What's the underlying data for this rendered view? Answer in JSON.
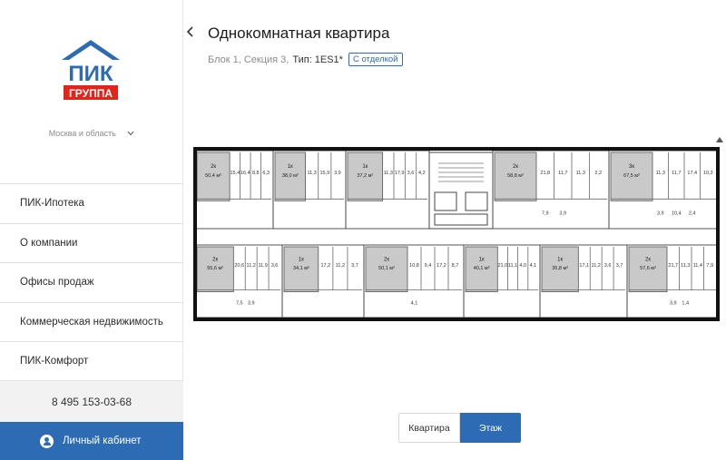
{
  "brand": {
    "logo_top": "ПИК",
    "logo_bottom": "ГРУППА",
    "blue": "#2d6bb5",
    "red": "#e3241b"
  },
  "region": {
    "label": "Москва и область",
    "icon": "chevron-down-icon"
  },
  "sidebar": {
    "items": [
      {
        "label": "ПИК-Ипотека"
      },
      {
        "label": "О компании"
      },
      {
        "label": "Офисы продаж"
      },
      {
        "label": "Коммерческая недвижимость"
      },
      {
        "label": "ПИК-Комфорт"
      }
    ],
    "phone": "8 495 153-03-68",
    "cabinet_label": "Личный кабинет"
  },
  "header": {
    "title": "Однокомнатная квартира",
    "block_section": "Блок 1, Секция 3,",
    "type_label": "Тип:",
    "type_value": "1ES1*",
    "badge": "С отделкой"
  },
  "plan": {
    "top_row": [
      {
        "rooms": "2к",
        "area": "50,4 м²",
        "sub": [
          "15,4",
          "16,4",
          "8,8",
          "6,3"
        ]
      },
      {
        "rooms": "1к",
        "area": "38,0 м²",
        "sub": [
          "11,3",
          "15,9",
          "3,9"
        ]
      },
      {
        "rooms": "1к",
        "area": "37,2 м²",
        "sub": [
          "11,3",
          "17,9",
          "3,6",
          "4,2"
        ]
      },
      {
        "rooms": "2к",
        "area": "58,8 м²",
        "sub": [
          "21,8",
          "11,7",
          "11,3",
          "2,2",
          "7,9",
          "3,9"
        ]
      },
      {
        "rooms": "3к",
        "area": "67,5 м²",
        "sub": [
          "11,3",
          "11,7",
          "17,4",
          "10,3",
          "3,9",
          "10,4",
          "2,4"
        ]
      }
    ],
    "bottom_row": [
      {
        "rooms": "2к",
        "area": "55,6 м²",
        "sub": [
          "20,6",
          "11,2",
          "11,9",
          "3,6",
          "7,5",
          "3,9"
        ]
      },
      {
        "rooms": "1к",
        "area": "34,1 м²",
        "sub": [
          "17,2",
          "11,2",
          "3,7"
        ]
      },
      {
        "rooms": "2к",
        "area": "50,1 м²",
        "sub": [
          "10,8",
          "9,4",
          "17,2",
          "8,7",
          "4,1"
        ]
      },
      {
        "rooms": "1к",
        "area": "40,1 м²",
        "sub": [
          "21,0",
          "11,1",
          "4,0",
          "4,1"
        ]
      },
      {
        "rooms": "1к",
        "area": "35,8 м²",
        "sub": [
          "17,1",
          "11,2",
          "3,6",
          "3,7"
        ]
      },
      {
        "rooms": "2к",
        "area": "57,6 м²",
        "sub": [
          "21,7",
          "11,3",
          "11,4",
          "7,9",
          "3,9",
          "1,4"
        ]
      }
    ]
  },
  "view_toggle": {
    "apartment": "Квартира",
    "floor": "Этаж",
    "active": "floor"
  }
}
